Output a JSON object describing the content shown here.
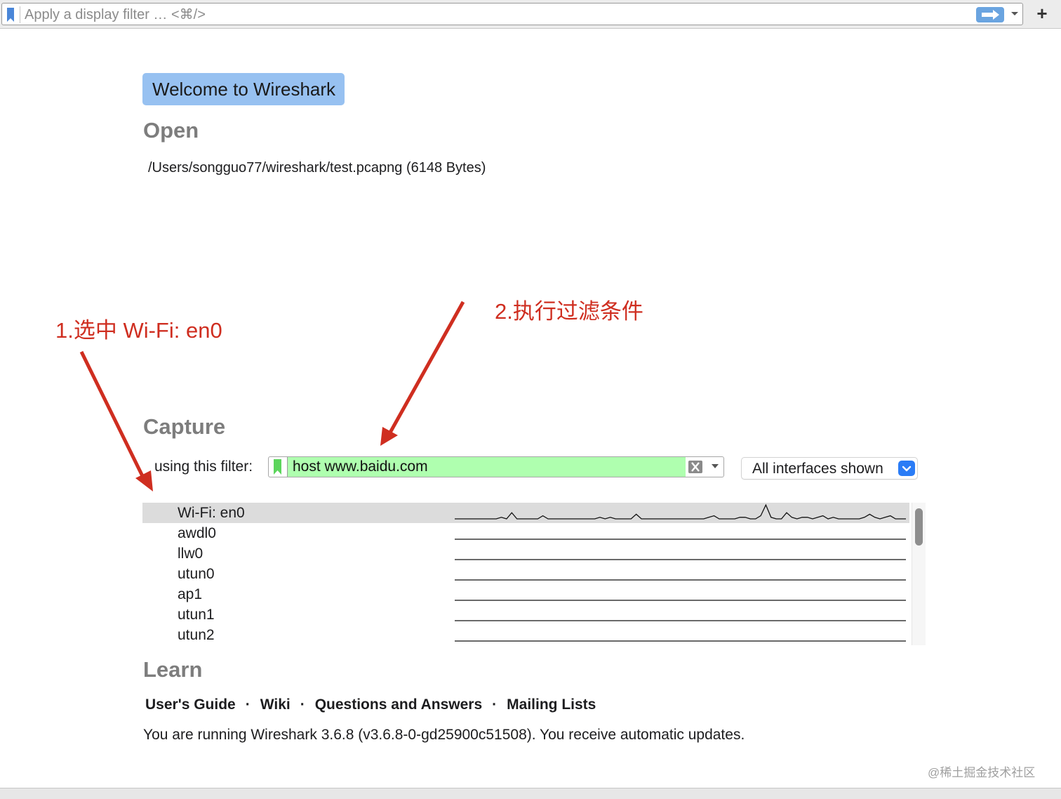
{
  "display_filter": {
    "placeholder": "Apply a display filter … <⌘/>",
    "add_button_label": "+"
  },
  "welcome": {
    "banner": "Welcome to Wireshark"
  },
  "open": {
    "title": "Open",
    "recent_files": [
      "/Users/songguo77/wireshark/test.pcapng (6148 Bytes)"
    ]
  },
  "annotations": {
    "step1": "1.选中 Wi-Fi: en0",
    "step2": "2.执行过滤条件",
    "color": "#cf2e20"
  },
  "capture": {
    "title": "Capture",
    "filter_label": "using this filter:",
    "filter_value": "host www.baidu.com",
    "filter_valid_color": "#afffaf",
    "interfaces_shown": "All interfaces shown",
    "interfaces": [
      {
        "name": "Wi-Fi: en0",
        "selected": true,
        "activity": [
          0,
          0,
          0,
          0,
          0,
          0,
          0,
          0,
          0,
          1,
          0,
          4,
          0,
          0,
          0,
          0,
          0,
          2,
          0,
          0,
          0,
          0,
          0,
          0,
          0,
          0,
          0,
          0,
          1,
          0,
          1,
          0,
          0,
          0,
          0,
          3,
          0,
          0,
          0,
          0,
          0,
          0,
          0,
          0,
          0,
          0,
          0,
          0,
          0,
          1,
          2,
          0,
          0,
          0,
          0,
          1,
          1,
          0,
          0,
          2,
          9,
          1,
          0,
          0,
          4,
          1,
          0,
          1,
          1,
          0,
          1,
          2,
          0,
          1,
          0,
          0,
          0,
          0,
          0,
          1,
          3,
          1,
          0,
          1,
          2,
          0,
          0,
          0
        ]
      },
      {
        "name": "awdl0",
        "selected": false,
        "activity": []
      },
      {
        "name": "llw0",
        "selected": false,
        "activity": []
      },
      {
        "name": "utun0",
        "selected": false,
        "activity": []
      },
      {
        "name": "ap1",
        "selected": false,
        "activity": []
      },
      {
        "name": "utun1",
        "selected": false,
        "activity": []
      },
      {
        "name": "utun2",
        "selected": false,
        "activity": []
      }
    ]
  },
  "learn": {
    "title": "Learn",
    "links": [
      "User's Guide",
      "Wiki",
      "Questions and Answers",
      "Mailing Lists"
    ],
    "separator": "·",
    "version_text": "You are running Wireshark 3.6.8 (v3.6.8-0-gd25900c51508). You receive automatic updates."
  },
  "watermark": "@稀土掘金技术社区"
}
